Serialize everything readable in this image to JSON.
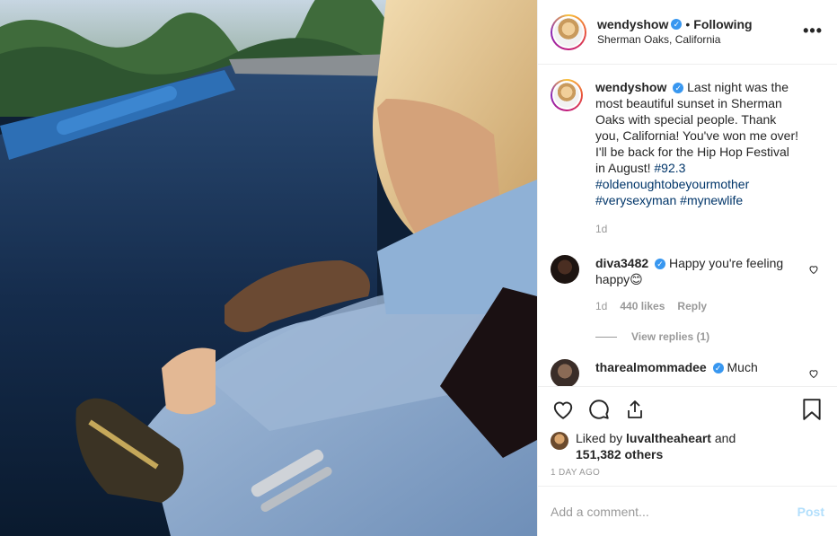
{
  "post": {
    "username": "wendyshow",
    "separator": "•",
    "follow_status": "Following",
    "location": "Sherman Oaks, California",
    "more_label": "•••"
  },
  "caption": {
    "username": "wendyshow",
    "text": "Last night was the most beautiful sunset in Sherman Oaks with special people. Thank you, California! You've won me over! I'll be back for the Hip Hop Festival in August!",
    "hashtags": [
      "#92.3",
      "#oldenoughtobeyourmother",
      "#verysexyman",
      "#mynewlife"
    ],
    "time": "1d"
  },
  "comments": [
    {
      "username": "diva3482",
      "text": "Happy you're feeling happy",
      "emoji": "😊",
      "time": "1d",
      "likes": "440 likes",
      "reply_label": "Reply",
      "view_replies": "View replies (1)"
    },
    {
      "username": "tharealmommadee",
      "text": "Much"
    }
  ],
  "likes": {
    "liked_by_prefix": "Liked by",
    "liked_by_user": "luvaltheaheart",
    "and": "and",
    "others": "151,382 others"
  },
  "timestamp": "1 DAY AGO",
  "comment_box": {
    "placeholder": "Add a comment...",
    "post_label": "Post"
  },
  "colors": {
    "link": "#003569",
    "verified": "#3897f0",
    "muted": "#999999",
    "post_disabled": "#b2dffc"
  }
}
